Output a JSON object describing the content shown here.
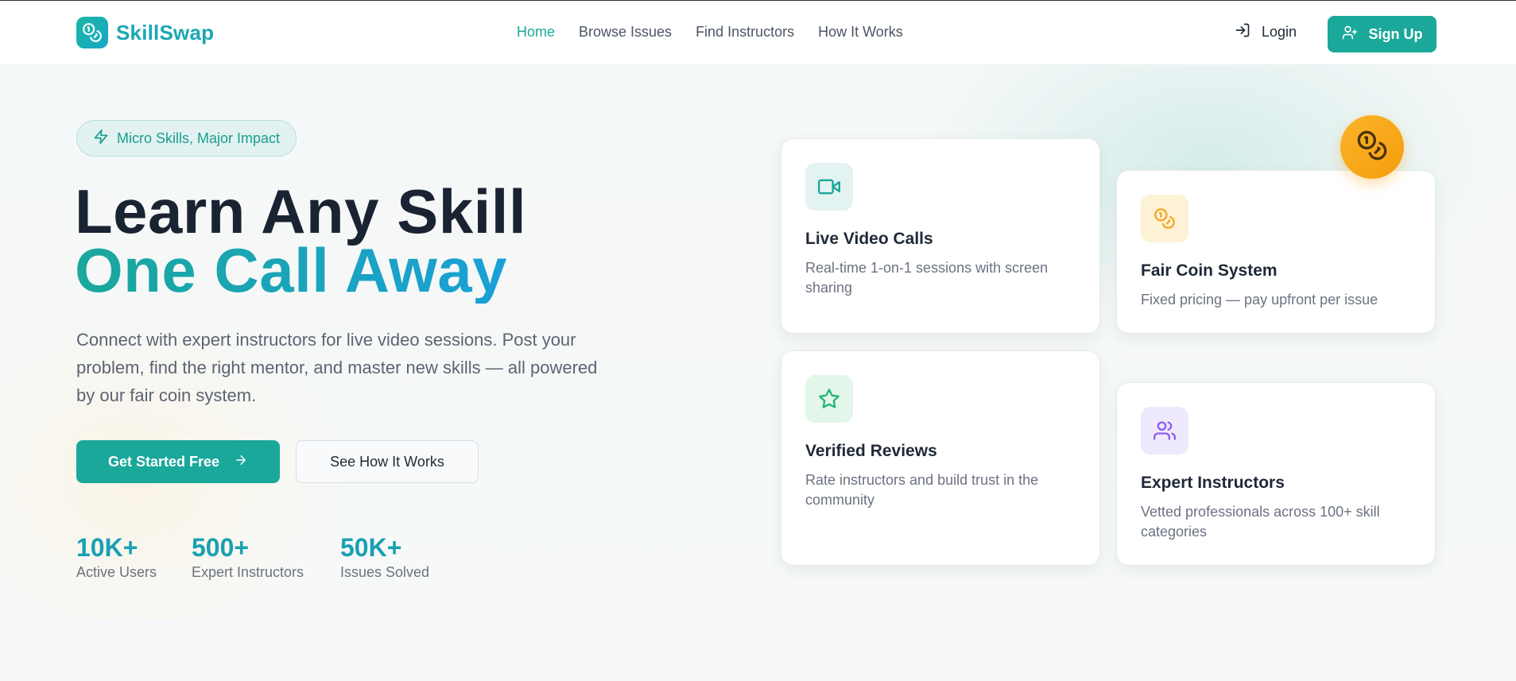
{
  "brand": {
    "name": "SkillSwap",
    "logo_icon": "coins-icon"
  },
  "nav": {
    "links": [
      {
        "label": "Home",
        "active": true
      },
      {
        "label": "Browse Issues",
        "active": false
      },
      {
        "label": "Find Instructors",
        "active": false
      },
      {
        "label": "How It Works",
        "active": false
      }
    ],
    "login_label": "Login",
    "login_icon": "log-in-icon",
    "signup_label": "Sign Up",
    "signup_icon": "user-plus-icon"
  },
  "hero": {
    "badge": "Micro Skills, Major Impact",
    "badge_icon": "zap-icon",
    "title_line1": "Learn Any Skill",
    "title_line2": "One Call Away",
    "description": "Connect with expert instructors for live video sessions. Post your problem, find the right mentor, and master new skills — all powered by our fair coin system.",
    "primary_cta": "Get Started Free",
    "primary_cta_icon": "arrow-right-icon",
    "secondary_cta": "See How It Works",
    "stats": [
      {
        "value": "10K+",
        "label": "Active Users"
      },
      {
        "value": "500+",
        "label": "Expert Instructors"
      },
      {
        "value": "50K+",
        "label": "Issues Solved"
      }
    ]
  },
  "features": [
    {
      "title": "Live Video Calls",
      "description": "Real-time 1-on-1 sessions with screen sharing",
      "icon": "video-icon",
      "accent": "#1aa89a"
    },
    {
      "title": "Fair Coin System",
      "description": "Fixed pricing — pay upfront per issue",
      "icon": "coins-icon",
      "accent": "#f5a524"
    },
    {
      "title": "Verified Reviews",
      "description": "Rate instructors and build trust in the community",
      "icon": "star-icon",
      "accent": "#22b573"
    },
    {
      "title": "Expert Instructors",
      "description": "Vetted professionals across 100+ skill categories",
      "icon": "users-icon",
      "accent": "#8b5cf6"
    }
  ],
  "colors": {
    "primary": "#1aa89a",
    "accent_blue": "#1aa0d8",
    "heading": "#1a2332",
    "coin": "#f59e0b"
  }
}
